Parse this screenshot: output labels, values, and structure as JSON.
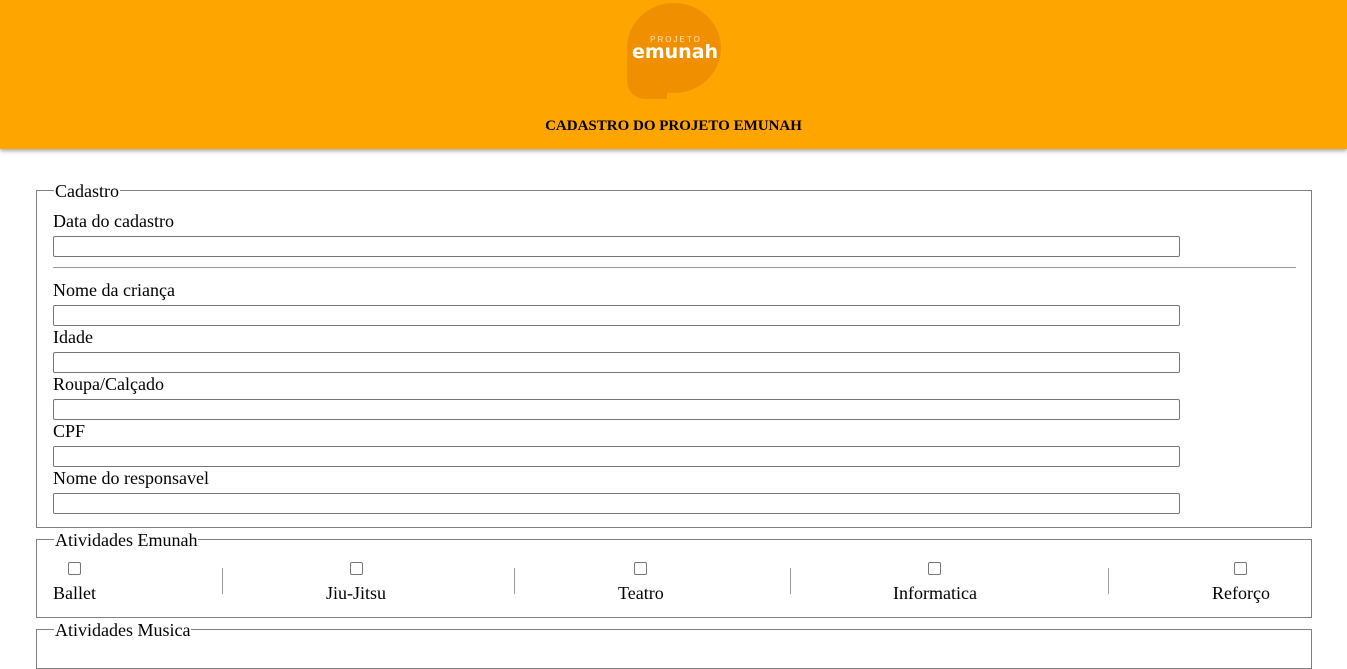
{
  "header": {
    "logo_small": "PROJETO",
    "logo_big": "emunah",
    "title": "CADASTRO DO PROJETO EMUNAH",
    "background": "#ffa500"
  },
  "cadastro": {
    "legend": "Cadastro",
    "fields": [
      {
        "label": "Data do cadastro",
        "value": ""
      },
      {
        "label": "Nome da criança",
        "value": ""
      },
      {
        "label": "Idade",
        "value": ""
      },
      {
        "label": "Roupa/Calçado",
        "value": ""
      },
      {
        "label": "CPF",
        "value": ""
      },
      {
        "label": "Nome do responsavel",
        "value": ""
      }
    ]
  },
  "atividades_emunah": {
    "legend": "Atividades Emunah",
    "items": [
      {
        "label": "Ballet",
        "checked": false
      },
      {
        "label": "Jiu-Jitsu",
        "checked": false
      },
      {
        "label": "Teatro",
        "checked": false
      },
      {
        "label": "Informatica",
        "checked": false
      },
      {
        "label": "Reforço",
        "checked": false
      }
    ]
  },
  "atividades_musica": {
    "legend": "Atividades Musica"
  }
}
